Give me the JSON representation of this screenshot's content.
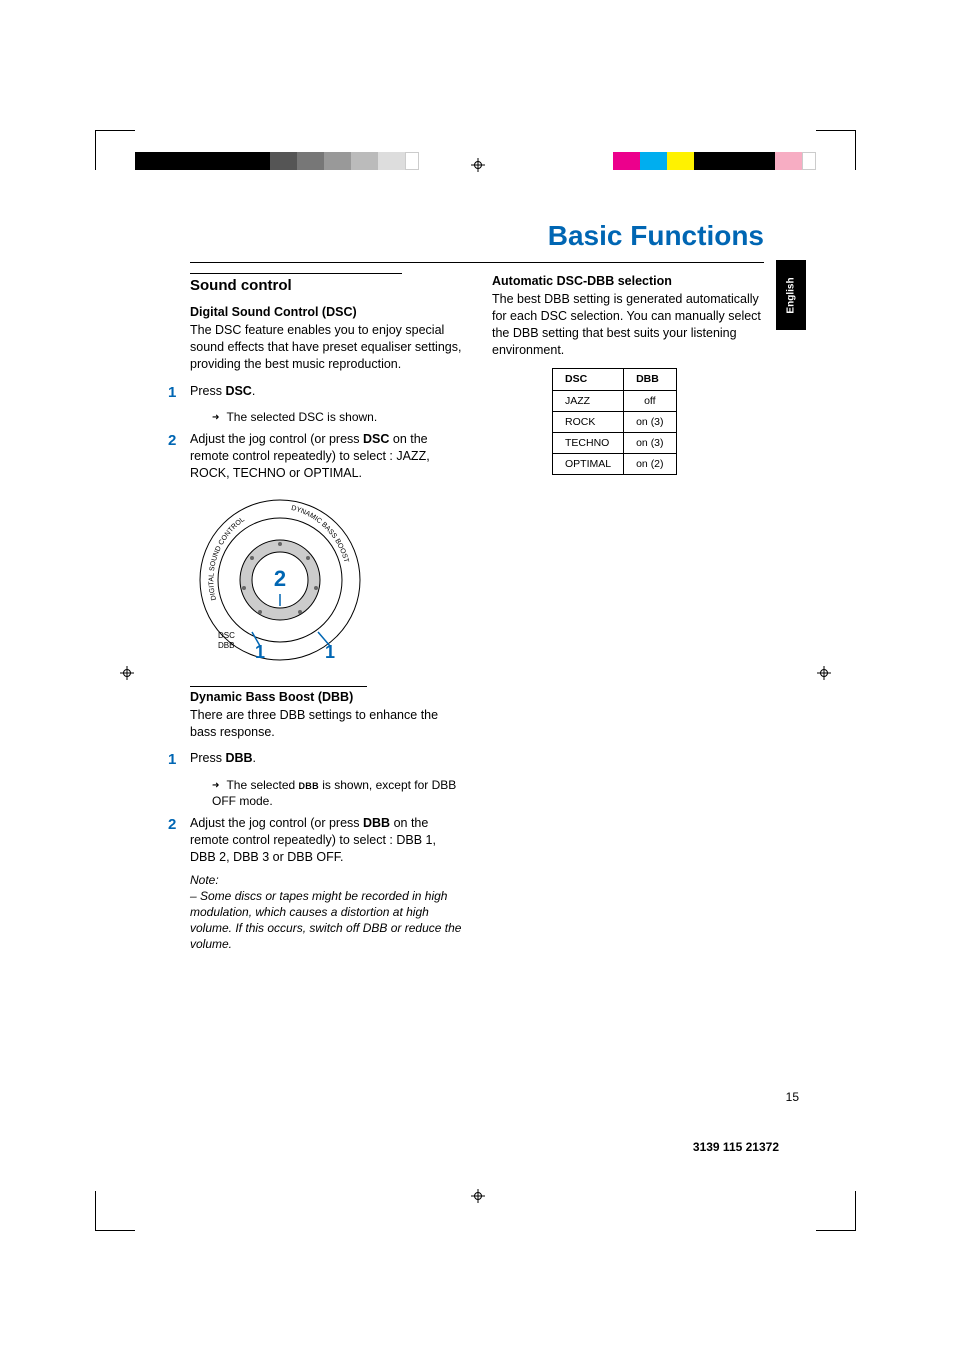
{
  "chapter_title": "Basic Functions",
  "lang_tab": "English",
  "page_num": "15",
  "doc_ref": "3139 115 21372",
  "left": {
    "section_title": "Sound control",
    "dsc": {
      "title": "Digital Sound Control (DSC)",
      "desc": "The DSC feature enables you to enjoy special sound effects that have preset equaliser settings, providing the best music reproduction.",
      "step1_pre": "Press ",
      "step1_bold": "DSC",
      "step1_post": ".",
      "step1_sub_pre": "The selected DSC is shown.",
      "step2_pre": "Adjust the jog control (or press ",
      "step2_bold": "DSC",
      "step2_post": " on the remote control repeatedly) to select : JAZZ, ROCK, TECHNO or OPTIMAL.",
      "dial_outer": "DIGITAL SOUND CONTROL",
      "dial_outer2": "DYNAMIC BASS BOOST",
      "dial_label1": "DSC",
      "dial_label2": "DBB"
    },
    "dbb": {
      "title": "Dynamic Bass Boost (DBB)",
      "desc": "There are three DBB settings to enhance the bass response.",
      "step1_pre": "Press ",
      "step1_bold": "DBB",
      "step1_post": ".",
      "step1_sub_pre": "The selected ",
      "step1_sub_bold": "DBB",
      "step1_sub_post": " is shown, except for DBB OFF mode.",
      "step2_pre": "Adjust the jog control (or press ",
      "step2_bold": "DBB",
      "step2_post": " on the remote control repeatedly) to select : DBB 1, DBB 2, DBB 3 or DBB OFF.",
      "note_label": "Note:",
      "note_body": "– Some discs or tapes might be recorded in high modulation, which causes a distortion at high volume. If this occurs, switch off DBB or reduce the volume."
    }
  },
  "right": {
    "auto": {
      "title": "Automatic DSC-DBB selection",
      "desc": "The best DBB setting is generated automatically for each DSC selection. You can manually select the DBB setting that best suits your listening environment."
    },
    "table": {
      "head1": "DSC",
      "head2": "DBB",
      "rows": [
        {
          "dsc": "JAZZ",
          "dbb": "off"
        },
        {
          "dsc": "ROCK",
          "dbb": "on (3)"
        },
        {
          "dsc": "TECHNO",
          "dbb": "on (3)"
        },
        {
          "dsc": "OPTIMAL",
          "dbb": "on (2)"
        }
      ]
    }
  },
  "colors": {
    "left_bar": [
      "#000",
      "#000",
      "#000",
      "#000",
      "#000",
      "#666",
      "#888",
      "#aaa",
      "#ccc",
      "#eee",
      "#fff"
    ],
    "right_bar": [
      "#ff00ff",
      "#00aeef",
      "#fff200",
      "#000",
      "#000",
      "#000",
      "#f7adc3",
      "#fff"
    ]
  }
}
